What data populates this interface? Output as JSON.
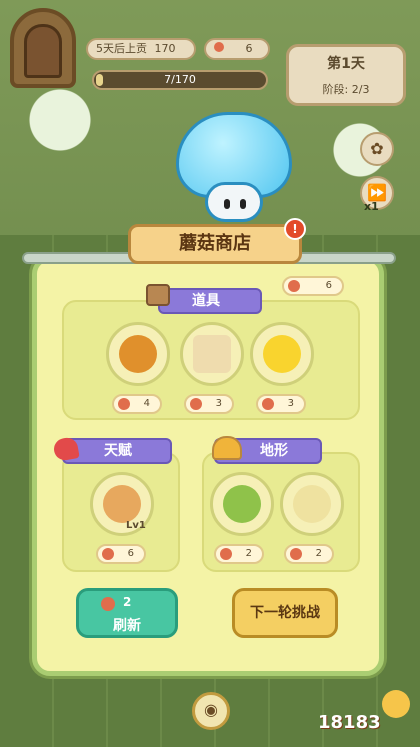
{
  "hud": {
    "tax_text": "5天后上贡",
    "tax_amount": "170",
    "mushroom_count": "6",
    "progress_text": "7/170",
    "progress_fraction": 0.041,
    "day_title": "第1天",
    "stage_text": "阶段: 2/3",
    "speed_label": "x1"
  },
  "shop": {
    "title": "蘑菇商店",
    "currency": "6",
    "sections": {
      "props": {
        "label": "道具",
        "items": [
          {
            "icon": "golden-mushroom-icon",
            "price": "4"
          },
          {
            "icon": "scroll-upgrade-icon",
            "price": "3"
          },
          {
            "icon": "sun-sunglasses-icon",
            "price": "3"
          }
        ]
      },
      "talent": {
        "label": "天赋",
        "items": [
          {
            "icon": "mushroom-family-icon",
            "level": "Lv1",
            "price": "6"
          }
        ]
      },
      "terrain": {
        "label": "地形",
        "items": [
          {
            "icon": "grass-tile-icon",
            "price": "2"
          },
          {
            "icon": "star-sand-tile-icon",
            "price": "2"
          }
        ]
      }
    },
    "refresh": {
      "count": "2",
      "label": "刷新"
    },
    "next_label": "下一轮挑战"
  },
  "watermark": "18183"
}
